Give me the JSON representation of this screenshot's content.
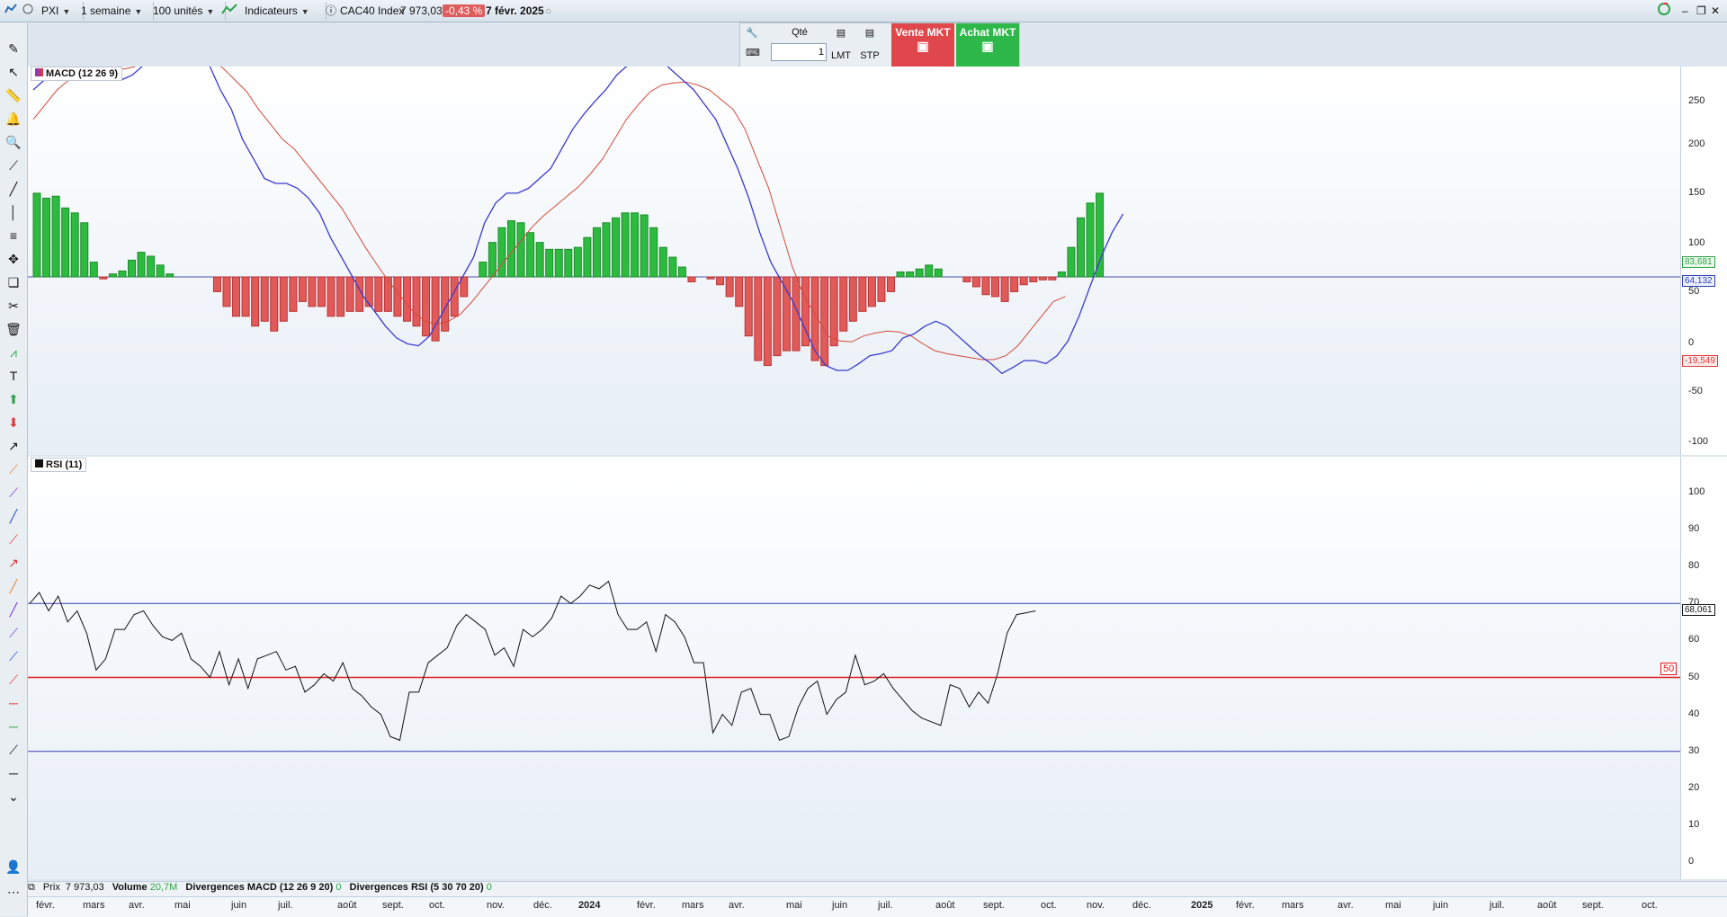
{
  "topbar": {
    "symbol": "PXI",
    "period": "1 semaine",
    "units": "100 unités",
    "indicators": "Indicateurs",
    "instrument": "CAC40 Index",
    "price": "7 973,03",
    "change": "-0,43 %",
    "date": "7 févr. 2025"
  },
  "order": {
    "qty_label": "Qté",
    "qty_value": "1",
    "lmt": "LMT",
    "stp": "STP",
    "sell": "Vente MKT",
    "buy": "Achat MKT"
  },
  "macd": {
    "legend": "MACD (12 26 9)",
    "ticks": [
      "250",
      "200",
      "150",
      "100",
      "50",
      "0",
      "-50",
      "-100"
    ],
    "tag_signal": "83,681",
    "tag_macd": "64,132",
    "tag_hist": "-19,549"
  },
  "rsi": {
    "legend": "RSI (11)",
    "ticks": [
      "100",
      "90",
      "80",
      "70",
      "60",
      "50",
      "40",
      "30",
      "20",
      "10",
      "0"
    ],
    "tag_value": "68,061",
    "level_label": "50"
  },
  "status": {
    "price_label": "Prix",
    "price_value": "7 973,03",
    "volume_label": "Volume",
    "volume_value": "20,7M",
    "div_macd": "Divergences MACD (12 26 9 20)",
    "div_macd_count": "0",
    "div_rsi": "Divergences RSI (5 30 70 20)",
    "div_rsi_count": "0"
  },
  "xaxis": [
    "févr.",
    "mars",
    "avr.",
    "mai",
    "juin",
    "juil.",
    "août",
    "sept.",
    "oct.",
    "nov.",
    "déc.",
    "2024",
    "févr.",
    "mars",
    "avr.",
    "mai",
    "juin",
    "juil.",
    "août",
    "sept.",
    "oct.",
    "nov.",
    "déc.",
    "2025",
    "févr.",
    "mars",
    "avr.",
    "mai",
    "juin",
    "juil.",
    "août",
    "sept.",
    "oct."
  ],
  "colors": {
    "up": "#2dbb3f",
    "down": "#e05a5a",
    "macd": "#3a3acf",
    "signal": "#d24a3a",
    "rsi": "#111111",
    "level50": "#e01b1b",
    "bands": "#3a3ab0"
  },
  "icons": [
    "pencil-icon",
    "cursor-icon",
    "ruler-icon",
    "bell-icon",
    "zoom-icon",
    "line-icon",
    "trash-icon",
    "text-icon",
    "arrow-up-icon",
    "arrow-down-icon"
  ]
}
